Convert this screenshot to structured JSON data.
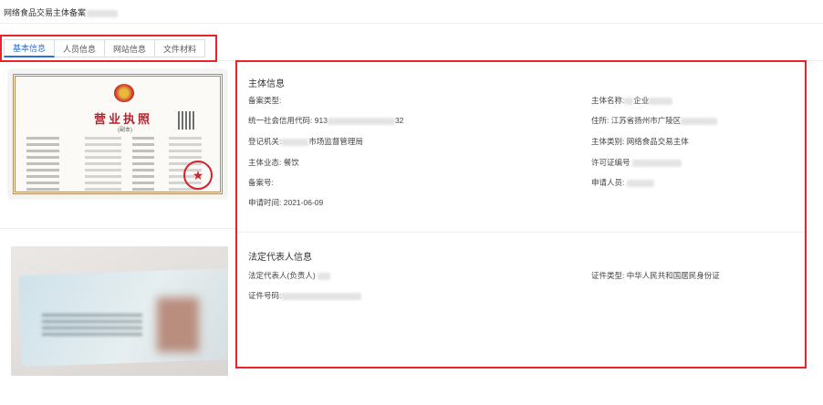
{
  "header": {
    "title": "网络食品交易主体备案"
  },
  "tabs": [
    {
      "label": "基本信息",
      "active": true
    },
    {
      "label": "人员信息",
      "active": false
    },
    {
      "label": "网站信息",
      "active": false
    },
    {
      "label": "文件材料",
      "active": false
    }
  ],
  "documents": {
    "license": {
      "title": "营业执照",
      "subtitle": "(副本)"
    },
    "id_card": {}
  },
  "subject_info": {
    "section_title": "主体信息",
    "filing_type_label": "备案类型:",
    "credit_code_label": "统一社会信用代码:",
    "credit_code_value": "913",
    "credit_code_suffix": "32",
    "registrar_label": "登记机关:",
    "registrar_value": "市场监督管理局",
    "business_form_label": "主体业态:",
    "business_form_value": "餐饮",
    "filing_no_label": "备案号:",
    "apply_time_label": "申请时间:",
    "apply_time_value": "2021-06-09",
    "subject_name_label": "主体名称:",
    "subject_name_value": "企业",
    "address_label": "住所:",
    "address_value": "江苏省扬州市广陵区",
    "subject_type_label": "主体类别:",
    "subject_type_value": "网络食品交易主体",
    "permit_no_label": "许可证编号",
    "applicant_label": "申请人员:"
  },
  "legal_rep": {
    "section_title": "法定代表人信息",
    "rep_label": "法定代表人(负责人)",
    "id_type_label": "证件类型:",
    "id_type_value": "中华人民共和国居民身份证",
    "id_no_label": "证件号码:"
  },
  "colors": {
    "highlight_border": "#e8232c",
    "active_tab": "#2d6fcf"
  }
}
